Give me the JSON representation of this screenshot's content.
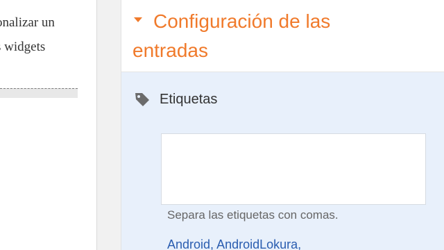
{
  "editor": {
    "line1": "onalizar un",
    "line2": "s widgets"
  },
  "settings": {
    "section_title_line1": "Configuración de las",
    "section_title_line2": "entradas",
    "labels": {
      "heading": "Etiquetas",
      "input_value": "",
      "hint": "Separa las etiquetas con comas.",
      "recent": [
        {
          "label": "Android"
        },
        {
          "label": "AndroidLokura"
        }
      ]
    }
  },
  "colors": {
    "accent_orange": "#f07a2b",
    "panel_blue": "#e8f0fb",
    "link_blue": "#2a5db0"
  },
  "icons": {
    "collapse": "triangle-down-icon",
    "labels": "tag-icon"
  }
}
